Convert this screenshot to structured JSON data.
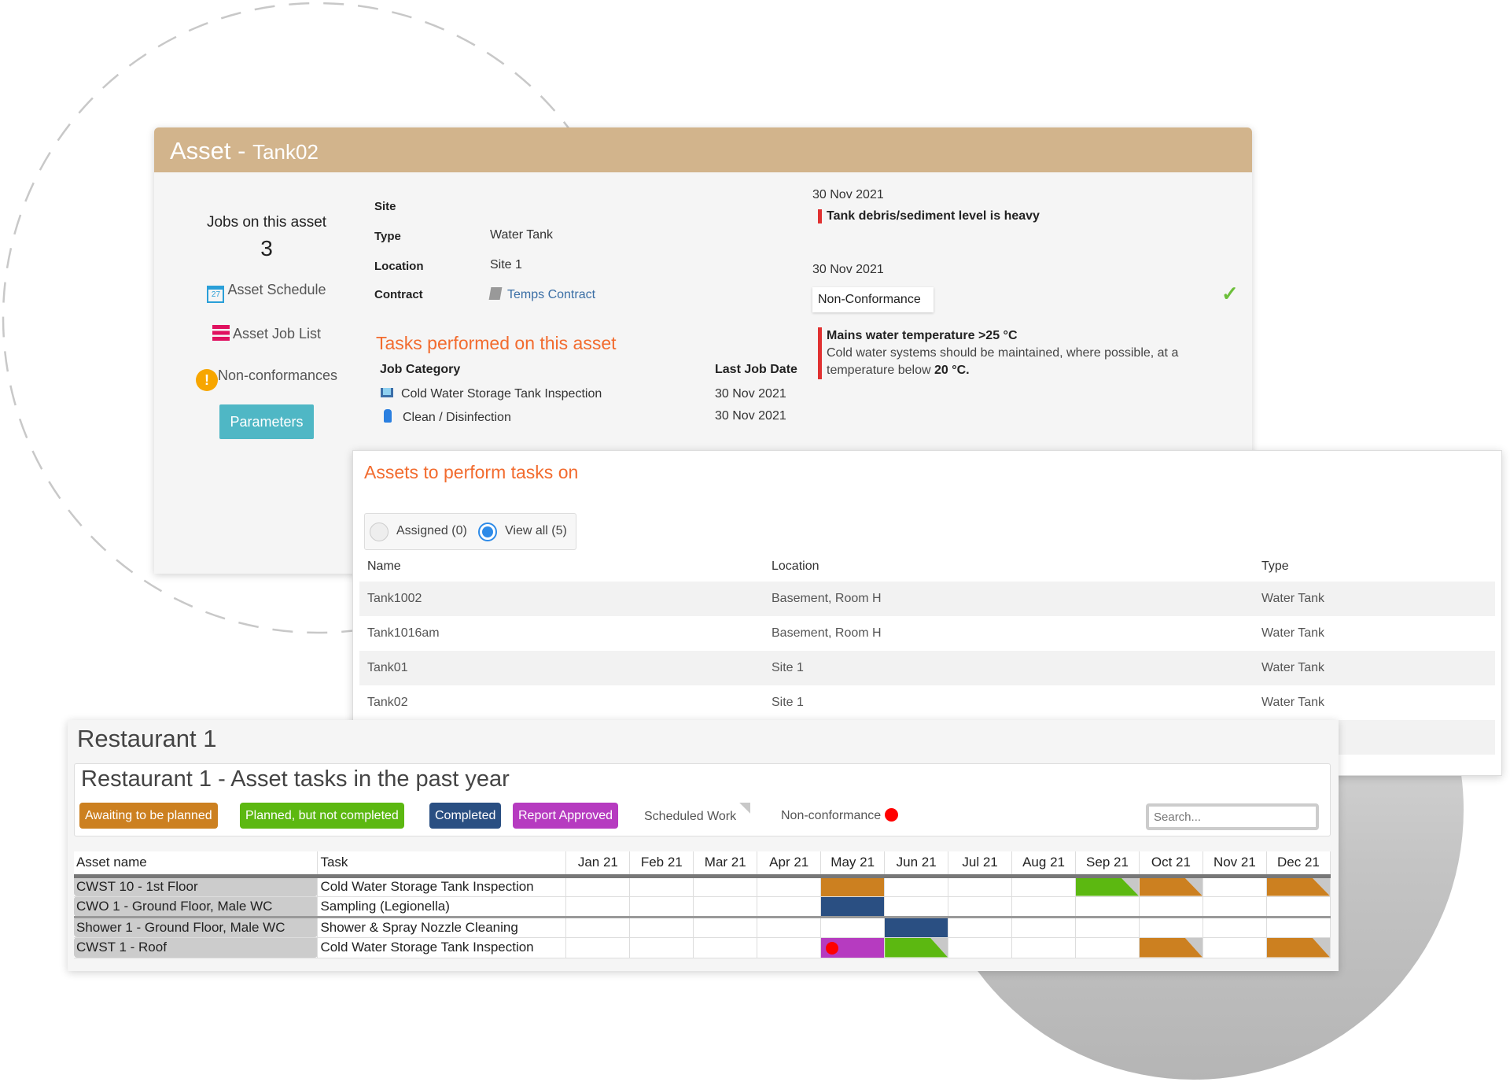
{
  "asset_panel": {
    "title_prefix": "Asset - ",
    "title_name": "Tank02",
    "jobs_label": "Jobs on this asset",
    "jobs_count": "3",
    "links": {
      "schedule": "Asset Schedule",
      "job_list": "Asset Job List",
      "nonconformances": "Non-conformances"
    },
    "parameters_button": "Parameters",
    "fields": [
      {
        "label": "Site",
        "value": ""
      },
      {
        "label": "Type",
        "value": "Water Tank"
      },
      {
        "label": "Location",
        "value": "Site 1"
      },
      {
        "label": "Contract",
        "value": "Temps Contract"
      }
    ],
    "tasks_heading": "Tasks performed on this asset",
    "tasks_headers": {
      "category": "Job Category",
      "date": "Last Job Date"
    },
    "tasks": [
      {
        "category": "Cold Water Storage Tank Inspection",
        "date": "30 Nov 2021",
        "icon": "tank-icon"
      },
      {
        "category": "Clean / Disinfection",
        "date": "30 Nov 2021",
        "icon": "spray-bottle-icon"
      }
    ],
    "events": [
      {
        "date": "30 Nov 2021",
        "title": "Tank debris/sediment level is heavy"
      },
      {
        "date": "30 Nov 2021",
        "badge": "Non-Conformance",
        "title": "Mains water temperature >25 °C",
        "body": "Cold water systems should be maintained, where possible, at a temperature below ",
        "body_bold": "20 °C."
      }
    ]
  },
  "assets_panel": {
    "title": "Assets to perform tasks on",
    "filters": [
      {
        "label": "Assigned (0)",
        "selected": false
      },
      {
        "label": "View all (5)",
        "selected": true
      }
    ],
    "headers": [
      "Name",
      "Location",
      "Type"
    ],
    "rows": [
      [
        "Tank1002",
        "Basement, Room H",
        "Water Tank"
      ],
      [
        "Tank1016am",
        "Basement, Room H",
        "Water Tank"
      ],
      [
        "Tank01",
        "Site 1",
        "Water Tank"
      ],
      [
        "Tank02",
        "Site 1",
        "Water Tank"
      ]
    ]
  },
  "restaurant": {
    "title": "Restaurant 1",
    "subtitle": "Restaurant 1 - Asset tasks in the past year",
    "legend": [
      {
        "label": "Awaiting to be planned",
        "color": "#cc8020"
      },
      {
        "label": "Planned, but not completed",
        "color": "#5cb811"
      },
      {
        "label": "Completed",
        "color": "#2a4f82"
      },
      {
        "label": "Report Approved",
        "color": "#b63bc0"
      }
    ],
    "scheduled_label": "Scheduled Work",
    "nonconformance_label": "Non-conformance",
    "search_placeholder": "Search...",
    "headers": {
      "asset": "Asset name",
      "task": "Task"
    },
    "months": [
      "Jan 21",
      "Feb 21",
      "Mar 21",
      "Apr 21",
      "May 21",
      "Jun 21",
      "Jul 21",
      "Aug 21",
      "Sep 21",
      "Oct 21",
      "Nov 21",
      "Dec 21"
    ],
    "rows": [
      {
        "asset": "CWST 10 - 1st Floor",
        "task": "Cold Water Storage Tank Inspection",
        "cells": {
          "May 21": {
            "status": "awaiting"
          },
          "Sep 21": {
            "status": "planned",
            "scheduled": true
          },
          "Oct 21": {
            "status": "awaiting",
            "scheduled": true
          },
          "Dec 21": {
            "status": "awaiting",
            "scheduled": true
          }
        }
      },
      {
        "asset": "CWO 1 - Ground Floor, Male WC",
        "task": "Sampling (Legionella)",
        "cells": {
          "May 21": {
            "status": "completed"
          }
        }
      },
      {
        "asset": "Shower 1 - Ground Floor, Male WC",
        "task": "Shower & Spray Nozzle Cleaning",
        "cells": {
          "Jun 21": {
            "status": "completed"
          }
        }
      },
      {
        "asset": "CWST 1 - Roof",
        "task": "Cold Water Storage Tank Inspection",
        "cells": {
          "May 21": {
            "status": "approved",
            "nonconformance": true
          },
          "Jun 21": {
            "status": "planned",
            "scheduled": true
          },
          "Oct 21": {
            "status": "awaiting",
            "scheduled": true
          },
          "Dec 21": {
            "status": "awaiting",
            "scheduled": true
          }
        }
      }
    ],
    "status_colors": {
      "awaiting": "#cc8020",
      "planned": "#5cb811",
      "completed": "#2a4f82",
      "approved": "#b63bc0"
    }
  }
}
